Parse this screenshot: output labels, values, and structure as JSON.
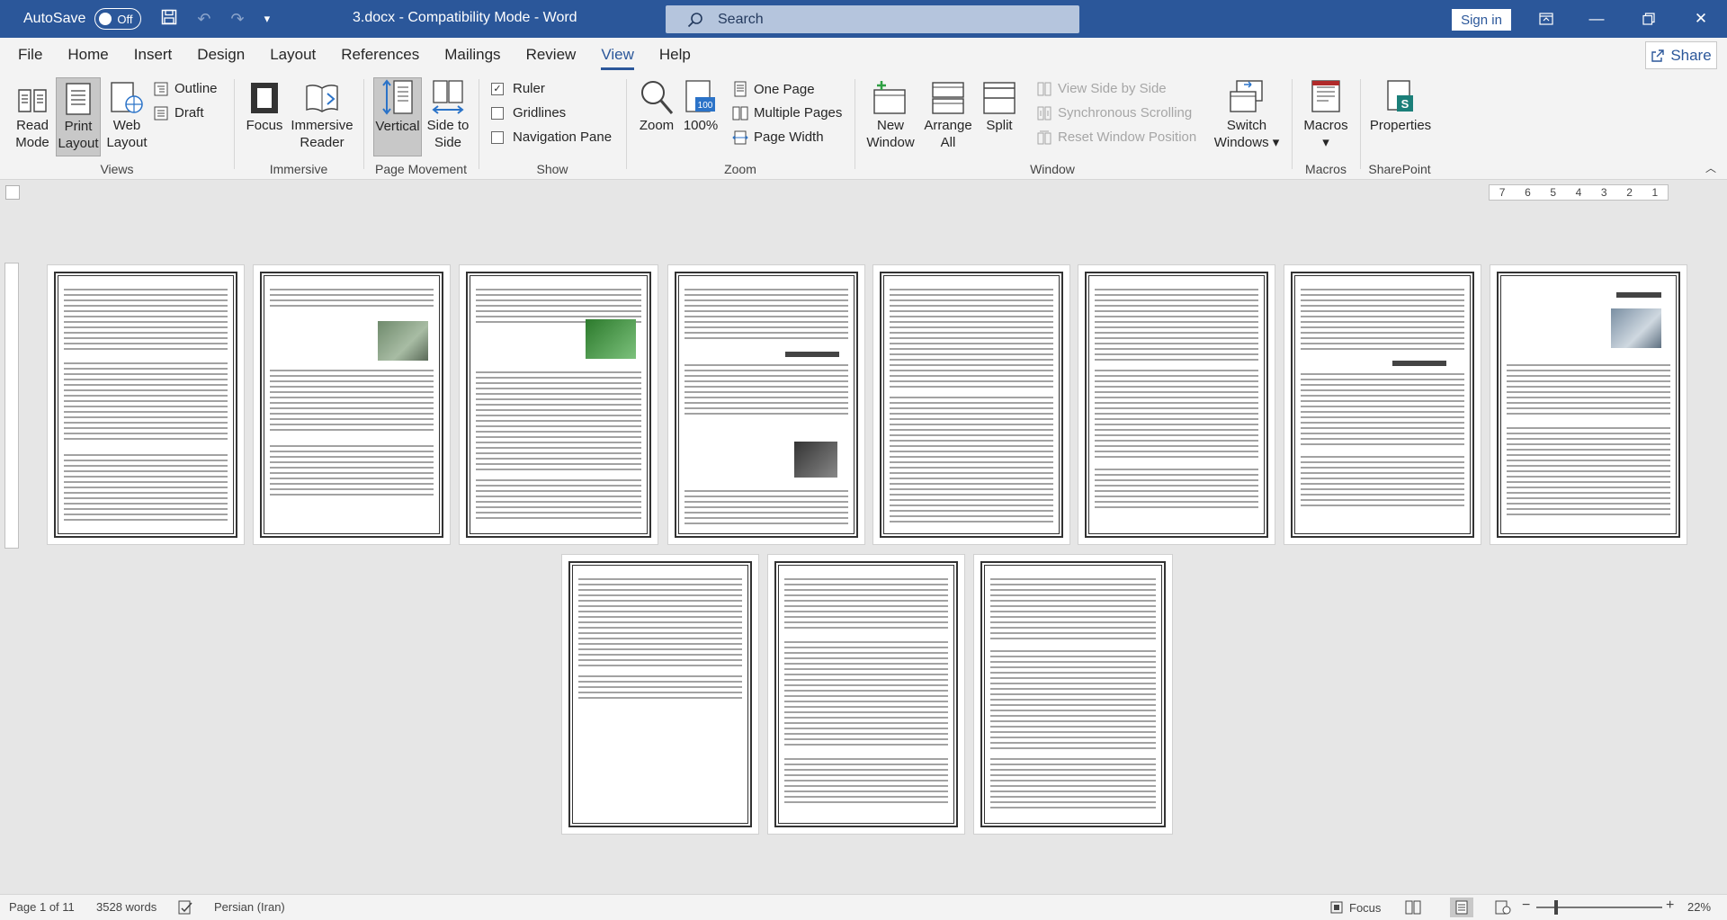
{
  "titlebar": {
    "autosave_label": "AutoSave",
    "autosave_state": "Off",
    "document_title": "3.docx  -  Compatibility Mode  -  Word",
    "search_placeholder": "Search",
    "signin_label": "Sign in"
  },
  "tabs": [
    "File",
    "Home",
    "Insert",
    "Design",
    "Layout",
    "References",
    "Mailings",
    "Review",
    "View",
    "Help"
  ],
  "active_tab": "View",
  "share_label": "Share",
  "ribbon": {
    "views": {
      "label": "Views",
      "read_mode": "Read Mode",
      "print_layout": "Print Layout",
      "web_layout": "Web Layout",
      "outline": "Outline",
      "draft": "Draft"
    },
    "immersive": {
      "label": "Immersive",
      "focus": "Focus",
      "immersive_reader": "Immersive Reader"
    },
    "page_movement": {
      "label": "Page Movement",
      "vertical": "Vertical",
      "side_to_side": "Side to Side"
    },
    "show": {
      "label": "Show",
      "ruler": "Ruler",
      "gridlines": "Gridlines",
      "navigation_pane": "Navigation Pane",
      "ruler_checked": true
    },
    "zoom": {
      "label": "Zoom",
      "zoom": "Zoom",
      "hundred": "100%",
      "one_page": "One Page",
      "multiple_pages": "Multiple Pages",
      "page_width": "Page Width"
    },
    "window": {
      "label": "Window",
      "new_window": "New Window",
      "arrange_all": "Arrange All",
      "split": "Split",
      "view_side_by_side": "View Side by Side",
      "synchronous_scrolling": "Synchronous Scrolling",
      "reset_window_position": "Reset Window Position",
      "switch_windows": "Switch Windows"
    },
    "macros": {
      "label": "Macros",
      "macros": "Macros"
    },
    "sharepoint": {
      "label": "SharePoint",
      "properties": "Properties"
    }
  },
  "ruler_numbers": [
    "7",
    "6",
    "5",
    "4",
    "3",
    "2",
    "1"
  ],
  "statusbar": {
    "page": "Page 1 of 11",
    "words": "3528 words",
    "language": "Persian (Iran)",
    "focus": "Focus",
    "zoom_minus": "−",
    "zoom_plus": "+",
    "zoom_level": "22%"
  },
  "colors": {
    "accent": "#2b579a"
  }
}
